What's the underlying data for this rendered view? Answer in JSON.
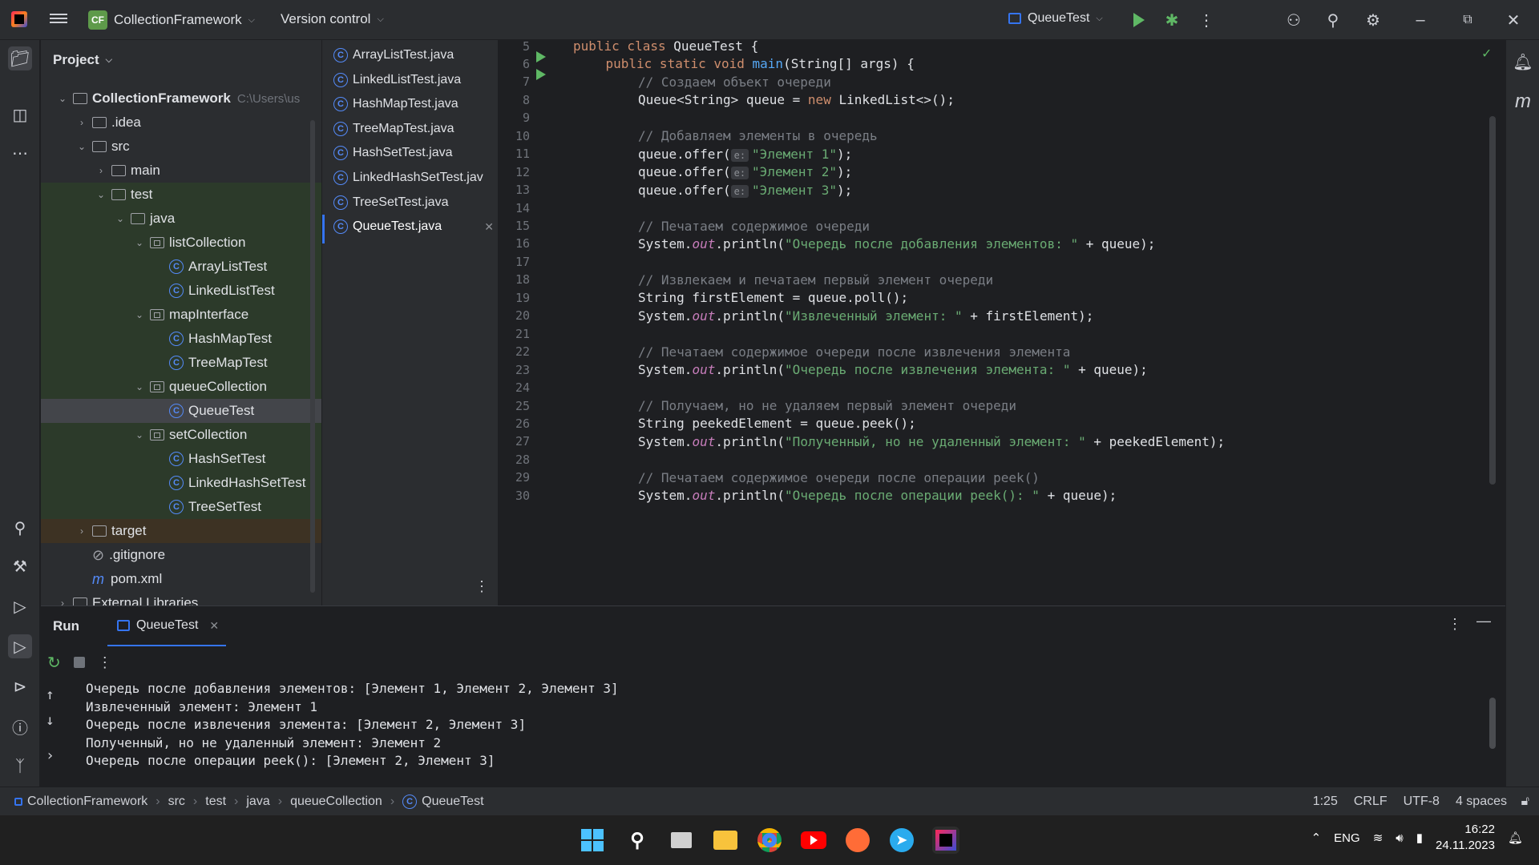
{
  "titlebar": {
    "project_badge": "CF",
    "project_name": "CollectionFramework",
    "vcs_label": "Version control",
    "run_config": "QueueTest"
  },
  "project_panel": {
    "title": "Project",
    "root_name": "CollectionFramework",
    "root_path": "C:\\Users\\us",
    "tree": [
      {
        "label": ".idea",
        "kind": "folder",
        "depth": 1,
        "arrow": "right"
      },
      {
        "label": "src",
        "kind": "folder",
        "depth": 1,
        "arrow": "down"
      },
      {
        "label": "main",
        "kind": "folder",
        "depth": 2,
        "arrow": "right"
      },
      {
        "label": "test",
        "kind": "folder",
        "depth": 2,
        "arrow": "down"
      },
      {
        "label": "java",
        "kind": "folder",
        "depth": 3,
        "arrow": "down"
      },
      {
        "label": "listCollection",
        "kind": "package",
        "depth": 4,
        "arrow": "down"
      },
      {
        "label": "ArrayListTest",
        "kind": "class",
        "depth": 5,
        "arrow": "none"
      },
      {
        "label": "LinkedListTest",
        "kind": "class",
        "depth": 5,
        "arrow": "none"
      },
      {
        "label": "mapInterface",
        "kind": "package",
        "depth": 4,
        "arrow": "down"
      },
      {
        "label": "HashMapTest",
        "kind": "class",
        "depth": 5,
        "arrow": "none"
      },
      {
        "label": "TreeMapTest",
        "kind": "class",
        "depth": 5,
        "arrow": "none"
      },
      {
        "label": "queueCollection",
        "kind": "package",
        "depth": 4,
        "arrow": "down"
      },
      {
        "label": "QueueTest",
        "kind": "class",
        "depth": 5,
        "arrow": "none",
        "selected": true
      },
      {
        "label": "setCollection",
        "kind": "package",
        "depth": 4,
        "arrow": "down"
      },
      {
        "label": "HashSetTest",
        "kind": "class",
        "depth": 5,
        "arrow": "none"
      },
      {
        "label": "LinkedHashSetTest",
        "kind": "class",
        "depth": 5,
        "arrow": "none"
      },
      {
        "label": "TreeSetTest",
        "kind": "class",
        "depth": 5,
        "arrow": "none"
      },
      {
        "label": "target",
        "kind": "folder",
        "depth": 1,
        "arrow": "right",
        "target": true
      },
      {
        "label": ".gitignore",
        "kind": "ignore",
        "depth": 1,
        "arrow": "none"
      },
      {
        "label": "pom.xml",
        "kind": "maven",
        "depth": 1,
        "arrow": "none"
      },
      {
        "label": "External Libraries",
        "kind": "lib",
        "depth": 0,
        "arrow": "right"
      }
    ]
  },
  "open_files": [
    {
      "label": "ArrayListTest.java"
    },
    {
      "label": "LinkedListTest.java"
    },
    {
      "label": "HashMapTest.java"
    },
    {
      "label": "TreeMapTest.java"
    },
    {
      "label": "HashSetTest.java"
    },
    {
      "label": "LinkedHashSetTest.jav"
    },
    {
      "label": "TreeSetTest.java"
    },
    {
      "label": "QueueTest.java",
      "active": true
    }
  ],
  "editor": {
    "lines": [
      {
        "n": "5",
        "run": true,
        "indent": 0,
        "segs": [
          [
            "kw",
            "public class "
          ],
          [
            "",
            "QueueTest {"
          ]
        ]
      },
      {
        "n": "6",
        "run": true,
        "indent": 1,
        "segs": [
          [
            "kw",
            "public static void "
          ],
          [
            "fn",
            "main"
          ],
          [
            "",
            "(String[] args) {"
          ]
        ]
      },
      {
        "n": "7",
        "indent": 2,
        "segs": [
          [
            "cm",
            "// Создаем объект очереди"
          ]
        ]
      },
      {
        "n": "8",
        "indent": 2,
        "segs": [
          [
            "",
            "Queue<String> queue = "
          ],
          [
            "kw",
            "new "
          ],
          [
            "",
            "LinkedList<>();"
          ]
        ]
      },
      {
        "n": "9",
        "indent": 0,
        "segs": []
      },
      {
        "n": "10",
        "indent": 2,
        "segs": [
          [
            "cm",
            "// Добавляем элементы в очередь"
          ]
        ]
      },
      {
        "n": "11",
        "indent": 2,
        "segs": [
          [
            "",
            "queue.offer("
          ],
          [
            "hint",
            "e:"
          ],
          [
            "str",
            "\"Элемент 1\""
          ],
          [
            "",
            ");"
          ]
        ]
      },
      {
        "n": "12",
        "indent": 2,
        "segs": [
          [
            "",
            "queue.offer("
          ],
          [
            "hint",
            "e:"
          ],
          [
            "str",
            "\"Элемент 2\""
          ],
          [
            "",
            ");"
          ]
        ]
      },
      {
        "n": "13",
        "indent": 2,
        "segs": [
          [
            "",
            "queue.offer("
          ],
          [
            "hint",
            "e:"
          ],
          [
            "str",
            "\"Элемент 3\""
          ],
          [
            "",
            ");"
          ]
        ]
      },
      {
        "n": "14",
        "indent": 0,
        "segs": []
      },
      {
        "n": "15",
        "indent": 2,
        "segs": [
          [
            "cm",
            "// Печатаем содержимое очереди"
          ]
        ]
      },
      {
        "n": "16",
        "indent": 2,
        "segs": [
          [
            "",
            "System."
          ],
          [
            "fld",
            "out"
          ],
          [
            "",
            ".println("
          ],
          [
            "str",
            "\"Очередь после добавления элементов: \""
          ],
          [
            "",
            " + queue);"
          ]
        ]
      },
      {
        "n": "17",
        "indent": 0,
        "segs": []
      },
      {
        "n": "18",
        "indent": 2,
        "segs": [
          [
            "cm",
            "// Извлекаем и печатаем первый элемент очереди"
          ]
        ]
      },
      {
        "n": "19",
        "indent": 2,
        "segs": [
          [
            "",
            "String firstElement = queue.poll();"
          ]
        ]
      },
      {
        "n": "20",
        "indent": 2,
        "segs": [
          [
            "",
            "System."
          ],
          [
            "fld",
            "out"
          ],
          [
            "",
            ".println("
          ],
          [
            "str",
            "\"Извлеченный элемент: \""
          ],
          [
            "",
            " + firstElement);"
          ]
        ]
      },
      {
        "n": "21",
        "indent": 0,
        "segs": []
      },
      {
        "n": "22",
        "indent": 2,
        "segs": [
          [
            "cm",
            "// Печатаем содержимое очереди после извлечения элемента"
          ]
        ]
      },
      {
        "n": "23",
        "indent": 2,
        "segs": [
          [
            "",
            "System."
          ],
          [
            "fld",
            "out"
          ],
          [
            "",
            ".println("
          ],
          [
            "str",
            "\"Очередь после извлечения элемента: \""
          ],
          [
            "",
            " + queue);"
          ]
        ]
      },
      {
        "n": "24",
        "indent": 0,
        "segs": []
      },
      {
        "n": "25",
        "indent": 2,
        "segs": [
          [
            "cm",
            "// Получаем, но не удаляем первый элемент очереди"
          ]
        ]
      },
      {
        "n": "26",
        "indent": 2,
        "segs": [
          [
            "",
            "String peekedElement = queue.peek();"
          ]
        ]
      },
      {
        "n": "27",
        "indent": 2,
        "segs": [
          [
            "",
            "System."
          ],
          [
            "fld",
            "out"
          ],
          [
            "",
            ".println("
          ],
          [
            "str",
            "\"Полученный, но не удаленный элемент: \""
          ],
          [
            "",
            " + peekedElement);"
          ]
        ]
      },
      {
        "n": "28",
        "indent": 0,
        "segs": []
      },
      {
        "n": "29",
        "indent": 2,
        "segs": [
          [
            "cm",
            "// Печатаем содержимое очереди после операции peek()"
          ]
        ]
      },
      {
        "n": "30",
        "indent": 2,
        "segs": [
          [
            "",
            "System."
          ],
          [
            "fld",
            "out"
          ],
          [
            "",
            ".println("
          ],
          [
            "str",
            "\"Очередь после операции peek(): \""
          ],
          [
            "",
            " + queue);"
          ]
        ]
      }
    ]
  },
  "run_panel": {
    "title": "Run",
    "tab_label": "QueueTest",
    "output": [
      "Очередь после добавления элементов: [Элемент 1, Элемент 2, Элемент 3]",
      "Извлеченный элемент: Элемент 1",
      "Очередь после извлечения элемента: [Элемент 2, Элемент 3]",
      "Полученный, но не удаленный элемент: Элемент 2",
      "Очередь после операции peek(): [Элемент 2, Элемент 3]"
    ]
  },
  "statusbar": {
    "breadcrumbs": [
      "CollectionFramework",
      "src",
      "test",
      "java",
      "queueCollection",
      "QueueTest"
    ],
    "position": "1:25",
    "line_sep": "CRLF",
    "encoding": "UTF-8",
    "indent": "4 spaces"
  },
  "taskbar": {
    "lang": "ENG",
    "time": "16:22",
    "date": "24.11.2023"
  },
  "colors": {
    "accent": "#3574f0",
    "run_green": "#5fb865",
    "keyword": "#cf8e6d",
    "string": "#6aab73",
    "comment": "#7a7e85"
  }
}
